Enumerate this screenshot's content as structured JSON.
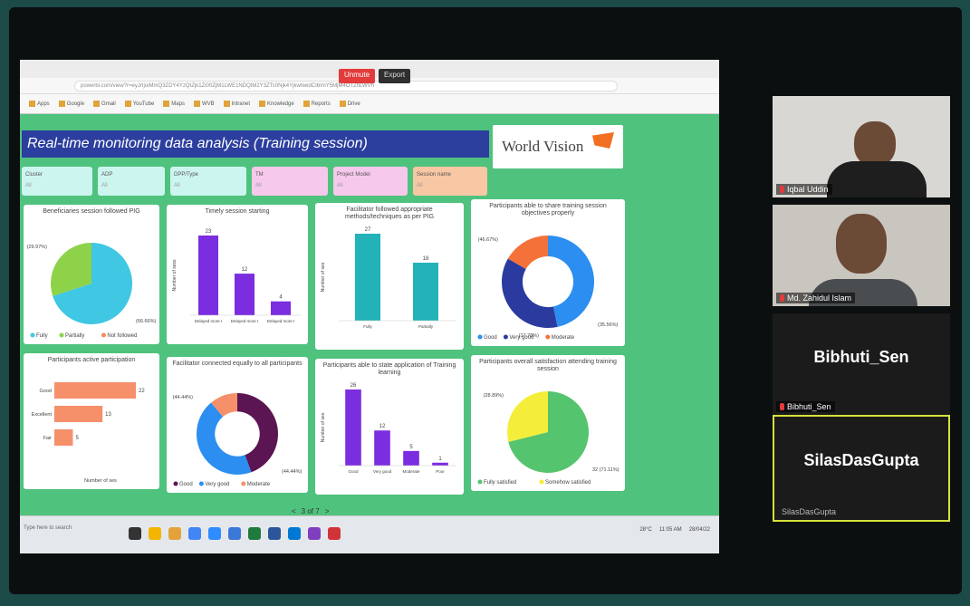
{
  "zoom_toolbar": {
    "record_label": "Unmute",
    "view_label": "Export"
  },
  "browser": {
    "url": "powerbi.com/view?r=eyJrIjoiMmQ3ZDY4YzQtZjk1Zi00ZjM1LWE1NDQtM2Y3ZTc0Njk4YjkwIiwidCI6ImY5MjM4OTZhLWVh",
    "bookmarks": [
      "Apps",
      "Google",
      "Gmail",
      "YouTube",
      "Maps",
      "WVB",
      "Intranet",
      "Knowledge",
      "Reports",
      "Drive"
    ]
  },
  "report": {
    "title": "Real-time monitoring data analysis (Training session)",
    "logo_text": "World Vision",
    "filters": [
      {
        "label": "Cluster",
        "value": "All",
        "color": "#cdf5f0"
      },
      {
        "label": "ADP",
        "value": "All",
        "color": "#cdf5f0"
      },
      {
        "label": "DPP/Type",
        "value": "All",
        "color": "#cdf5f0"
      },
      {
        "label": "TM",
        "value": "All",
        "color": "#f6c9ec"
      },
      {
        "label": "Project Model",
        "value": "All",
        "color": "#f6c9ec"
      },
      {
        "label": "Session name",
        "value": "All",
        "color": "#f8c7a4"
      }
    ],
    "page_indicator": "3 of 7"
  },
  "chart_data": [
    {
      "type": "pie",
      "title": "Beneficiaries session followed PIG",
      "labels": [
        "Fully",
        "Partially",
        "Not followed"
      ],
      "values": [
        70,
        30,
        0
      ],
      "data_labels": [
        "(29.97%)",
        "(66.66%)"
      ],
      "colors": [
        "#3fc7e3",
        "#8ed24a",
        "#f58a5b"
      ]
    },
    {
      "type": "bar",
      "title": "Timely session starting",
      "ylabel": "Number of sess",
      "categories": [
        "Delayed more than 30 minutes",
        "Delayed more than 15 minutes",
        "Delayed more than 60 minutes"
      ],
      "values": [
        23,
        12,
        4
      ],
      "color": "#7b2de0"
    },
    {
      "type": "bar",
      "title": "Facilitator followed appropriate methods/techniques as per PIG",
      "ylabel": "Number of ses",
      "categories": [
        "Fully",
        "Partially"
      ],
      "values": [
        27,
        18
      ],
      "color": "#21b3b7"
    },
    {
      "type": "pie",
      "title": "Participants able to share training session objectives properly",
      "labels": [
        "Good",
        "Very good",
        "Moderate"
      ],
      "values": [
        46.67,
        36.66,
        16.67
      ],
      "data_labels": [
        "(46.67%)",
        "(35.56%)",
        "(17.78%)"
      ],
      "colors": [
        "#2b8ef0",
        "#2a3a9e",
        "#f5713a"
      ]
    },
    {
      "type": "bar",
      "orientation": "horizontal",
      "title": "Participants active participation",
      "xlabel": "Number of ses",
      "categories": [
        "Good",
        "Excellent",
        "Fair"
      ],
      "values": [
        22,
        13,
        5
      ],
      "color": "#f5906a"
    },
    {
      "type": "pie",
      "title": "Facilitator connected equally to all participants",
      "labels": [
        "Good",
        "Very good",
        "Moderate"
      ],
      "values": [
        44.44,
        44.44,
        11.12
      ],
      "data_labels": [
        "(44.44%)",
        "(44.44%)"
      ],
      "colors": [
        "#5b1552",
        "#2b8ef0",
        "#f5906a"
      ]
    },
    {
      "type": "bar",
      "title": "Participants able to state application of Training learning",
      "ylabel": "Number of ses",
      "categories": [
        "Good",
        "Very good",
        "Moderate",
        "Poor"
      ],
      "values": [
        26,
        12,
        5,
        1
      ],
      "color": "#7b2de0"
    },
    {
      "type": "pie",
      "title": "Participants overall satisfaction attending training session",
      "labels": [
        "Fully satisfied",
        "Somehow satisfied"
      ],
      "values": [
        71.11,
        28.89
      ],
      "data_labels": [
        "(28.89%)",
        "32 (71.11%)"
      ],
      "colors": [
        "#55c46e",
        "#f4ee3a"
      ]
    }
  ],
  "taskbar": {
    "search": "Type here to search",
    "weather": "28°C",
    "time": "11:05 AM",
    "date": "28/04/22"
  },
  "participants": [
    {
      "name": "Iqbal Uddin"
    },
    {
      "name": "Md. Zahidul Islam"
    },
    {
      "name": "Bibhuti_Sen",
      "big_name": "Bibhuti_Sen"
    },
    {
      "name": "SilasDasGupta",
      "big_name": "SilasDasGupta"
    }
  ]
}
